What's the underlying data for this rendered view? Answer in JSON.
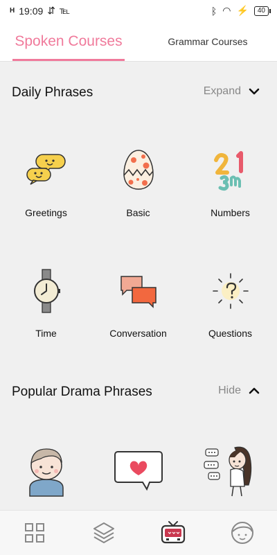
{
  "status_bar": {
    "signal": "H",
    "time": "19:09",
    "usb": "⇵",
    "notification": "℡",
    "bluetooth": "ᛒ",
    "wifi": "◠",
    "charging": "⚡",
    "battery": "40"
  },
  "tabs": [
    {
      "label": "Spoken Courses",
      "active": true
    },
    {
      "label": "Grammar Courses",
      "active": false
    }
  ],
  "sections": [
    {
      "title": "Daily Phrases",
      "toggle": "Expand",
      "toggle_icon": "chevron-down-icon",
      "items": [
        {
          "label": "Greetings",
          "icon": "speech-bubbles-icon"
        },
        {
          "label": "Basic",
          "icon": "cracked-egg-icon"
        },
        {
          "label": "Numbers",
          "icon": "numbers-icon"
        },
        {
          "label": "Time",
          "icon": "wristwatch-icon"
        },
        {
          "label": "Conversation",
          "icon": "conversation-icon"
        },
        {
          "label": "Questions",
          "icon": "question-bulb-icon"
        }
      ]
    },
    {
      "title": "Popular Drama Phrases",
      "toggle": "Hide",
      "toggle_icon": "chevron-up-icon",
      "items": [
        {
          "icon": "boy-avatar-icon"
        },
        {
          "icon": "heart-bubble-icon"
        },
        {
          "icon": "girl-chatting-icon"
        }
      ]
    }
  ],
  "bottom_nav": [
    {
      "icon": "grid-icon"
    },
    {
      "icon": "layers-icon"
    },
    {
      "icon": "tv-icon",
      "active": true
    },
    {
      "icon": "profile-face-icon"
    }
  ],
  "colors": {
    "accent": "#f07a9b",
    "background": "#f0f0f0",
    "tv_accent": "#c9384f"
  }
}
